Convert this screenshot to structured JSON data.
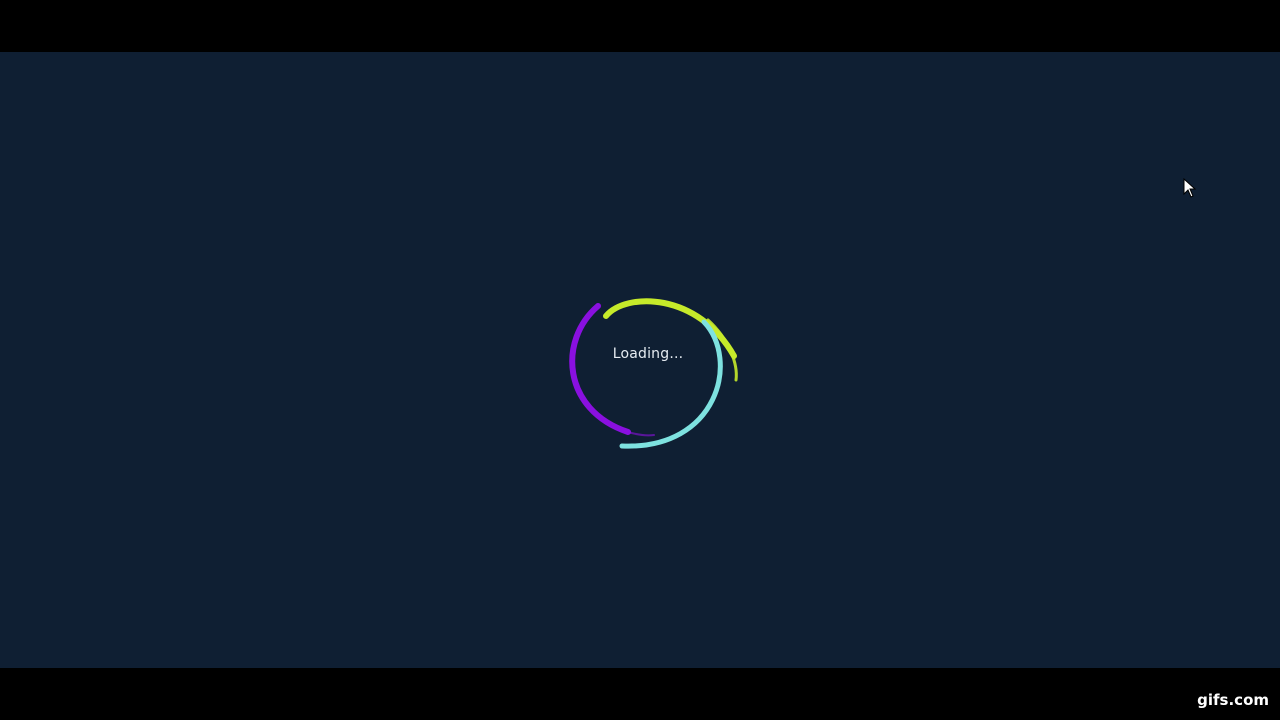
{
  "loader": {
    "text": "Loading...",
    "arc_colors": [
      "#c6ea2a",
      "#8a10e0",
      "#7ee2e0"
    ]
  },
  "watermark": {
    "text": "gifs.com"
  },
  "colors": {
    "background": "#0f1f33",
    "letterbox": "#000000"
  }
}
